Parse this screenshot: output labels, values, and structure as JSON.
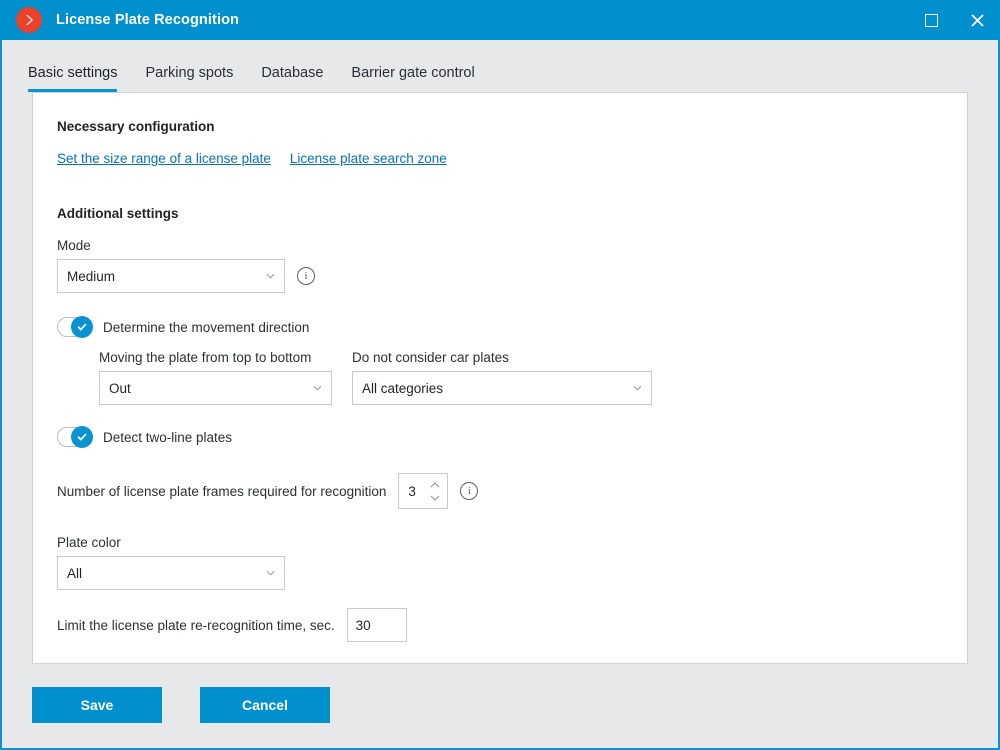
{
  "window": {
    "title": "License Plate Recognition",
    "logo_icon": "chevron-right-logo",
    "maximize_icon": "maximize-icon",
    "close_icon": "close-icon",
    "close_glyph": "✕",
    "accent_color": "#0090ce",
    "logo_color": "#e8422a",
    "background_color": "#e6e8ea",
    "panel_color": "#ffffff",
    "link_color": "#0a72b8"
  },
  "tabs": [
    {
      "label": "Basic settings",
      "active": true
    },
    {
      "label": "Parking spots",
      "active": false
    },
    {
      "label": "Database",
      "active": false
    },
    {
      "label": "Barrier gate control",
      "active": false
    }
  ],
  "necessary_configuration": {
    "heading": "Necessary configuration",
    "links": [
      {
        "label": "Set the size range of a license plate"
      },
      {
        "label": "License plate search zone"
      }
    ]
  },
  "additional_settings": {
    "heading": "Additional settings",
    "mode": {
      "label": "Mode",
      "value": "Medium",
      "options": [
        "Medium"
      ],
      "info_icon": "info-icon",
      "info_glyph": "i",
      "chevron_icon": "chevron-down-icon"
    },
    "movement_direction": {
      "toggle_label": "Determine the movement direction",
      "toggle_on": true,
      "check_icon": "check-icon",
      "top_to_bottom": {
        "label": "Moving the plate from top to bottom",
        "value": "Out",
        "options": [
          "Out"
        ],
        "chevron_icon": "chevron-down-icon"
      },
      "ignore_plates": {
        "label": "Do not consider car plates",
        "value": "All categories",
        "options": [
          "All categories"
        ],
        "chevron_icon": "chevron-down-icon"
      }
    },
    "two_line_plates": {
      "toggle_label": "Detect two-line plates",
      "toggle_on": true,
      "check_icon": "check-icon"
    },
    "frames_required": {
      "label": "Number of license plate frames required for recognition",
      "value": "3",
      "up_icon": "chevron-up-icon",
      "down_icon": "chevron-down-icon",
      "info_icon": "info-icon",
      "info_glyph": "i"
    },
    "plate_color": {
      "label": "Plate color",
      "value": "All",
      "options": [
        "All"
      ],
      "chevron_icon": "chevron-down-icon"
    },
    "re_recognition_time": {
      "label": "Limit the license plate re-recognition time, sec.",
      "value": "30",
      "placeholder": ""
    }
  },
  "footer": {
    "save_label": "Save",
    "cancel_label": "Cancel"
  }
}
